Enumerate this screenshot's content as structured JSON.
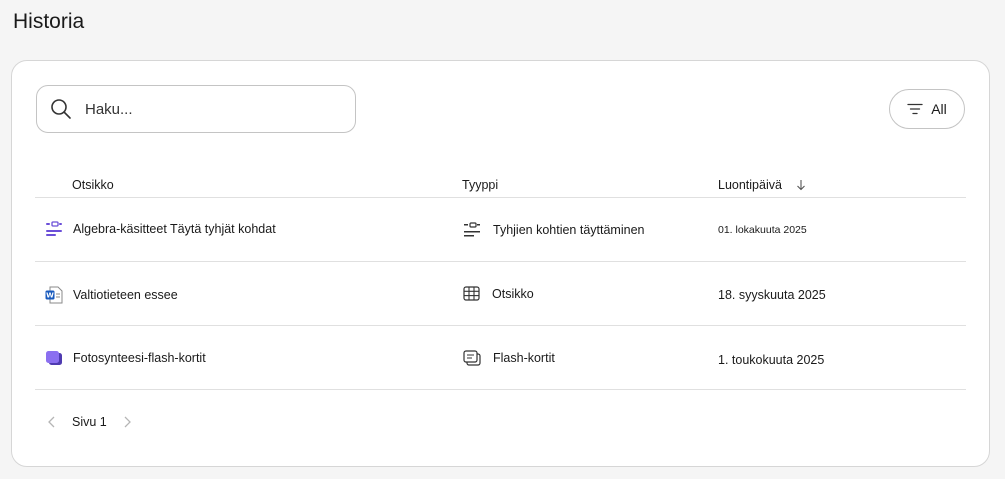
{
  "page": {
    "title": "Historia"
  },
  "search": {
    "placeholder": "Haku..."
  },
  "filter": {
    "label": "All",
    "icon": "filter-lines-icon"
  },
  "table": {
    "columns": {
      "title": "Otsikko",
      "type": "Tyyppi",
      "created": "Luontipäivä"
    },
    "sort": {
      "column": "created",
      "direction": "descending"
    },
    "rows": [
      {
        "title": "Algebra-käsitteet Täytä tyhjät kohdat",
        "title_icon": "fill-in-blanks-icon",
        "type": "Tyhjien kohtien täyttäminen",
        "type_icon": "fill-in-blanks-icon",
        "created": "01. lokakuuta 2025"
      },
      {
        "title": "Valtiotieteen essee",
        "title_icon": "word-document-icon",
        "type": "Otsikko",
        "type_icon": "grid-table-icon",
        "created": "18. syyskuuta 2025"
      },
      {
        "title": "Fotosynteesi-flash-kortit",
        "title_icon": "flashcards-icon",
        "type": "Flash-kortit",
        "type_icon": "flashcards-outline-icon",
        "created": "1. toukokuuta 2025"
      }
    ]
  },
  "pagination": {
    "label": "Sivu 1"
  },
  "colors": {
    "accent": "#6b4fd8",
    "word_blue": "#185abd",
    "border": "#d6d6d6"
  }
}
